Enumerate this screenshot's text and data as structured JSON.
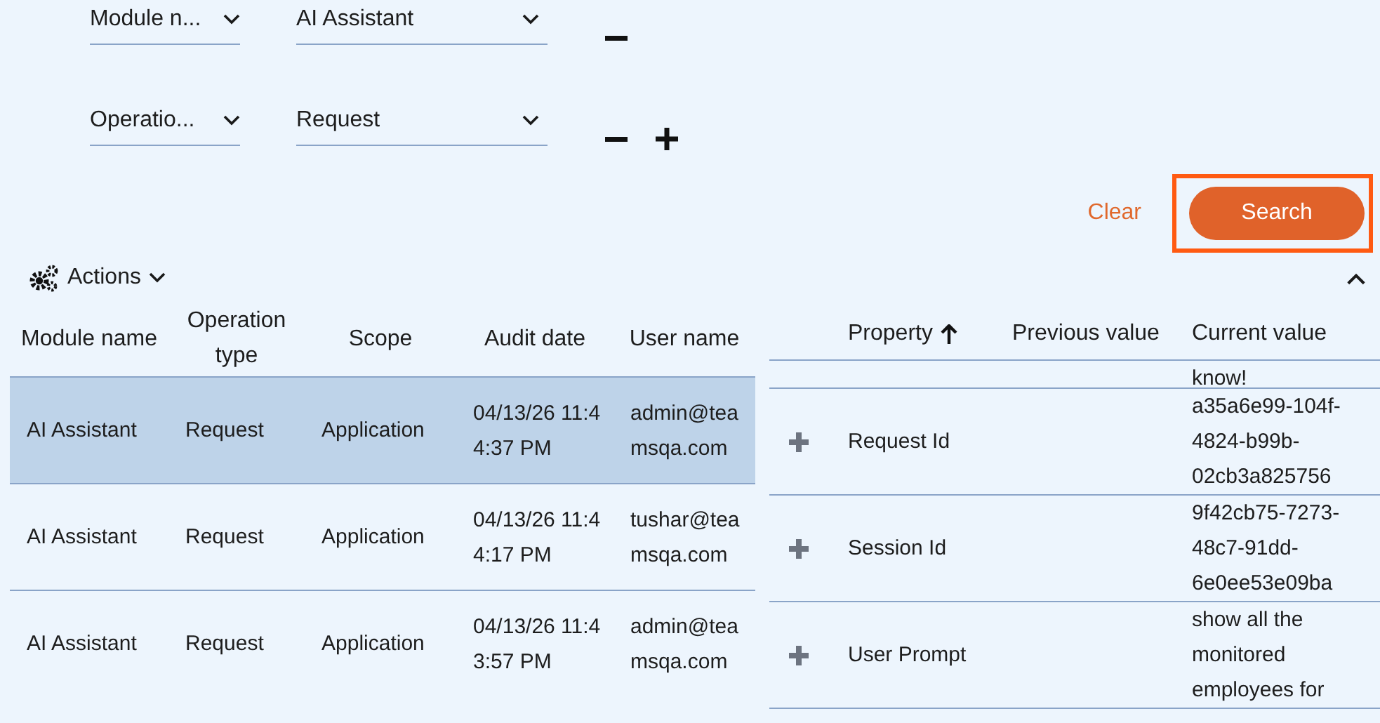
{
  "filters": [
    {
      "field": "Module n...",
      "value": "AI Assistant",
      "removable": true,
      "addable": false
    },
    {
      "field": "Operatio...",
      "value": "Request",
      "removable": true,
      "addable": true
    }
  ],
  "buttons": {
    "clear": "Clear",
    "search": {
      "label": "Search",
      "focused": true
    }
  },
  "actions_menu": {
    "label": "Actions"
  },
  "panel": {
    "expanded": true
  },
  "audit_table": {
    "columns": [
      "Module name",
      "Operation type",
      "Scope",
      "Audit date",
      "User name"
    ],
    "rows": [
      {
        "selected": true,
        "cells": [
          "AI Assistant",
          "Request",
          "Application",
          "04/13/26 11:44:37 PM",
          "admin@teamsqa.com"
        ]
      },
      {
        "selected": false,
        "cells": [
          "AI Assistant",
          "Request",
          "Application",
          "04/13/26 11:44:17 PM",
          "tushar@teamsqa.com"
        ]
      },
      {
        "selected": false,
        "cells": [
          "AI Assistant",
          "Request",
          "Application",
          "04/13/26 11:43:57 PM",
          "admin@teamsqa.com"
        ]
      }
    ]
  },
  "details_table": {
    "columns": [
      {
        "label": "Property",
        "sorted_ascending": true
      },
      {
        "label": "Previous value",
        "sorted_ascending": false
      },
      {
        "label": "Current value",
        "sorted_ascending": false
      }
    ],
    "rows": [
      {
        "kind": "partial",
        "property": "",
        "previous": "",
        "current": "know!"
      },
      {
        "kind": "row",
        "property": "Request Id",
        "previous": "",
        "current": "a35a6e99-104f-4824-b99b-02cb3a825756"
      },
      {
        "kind": "row",
        "property": "Session Id",
        "previous": "",
        "current": "9f42cb75-7273-48c7-91dd-6e0ee53e09ba"
      },
      {
        "kind": "row",
        "property": "User Prompt",
        "previous": "",
        "current": "show all the monitored employees for"
      }
    ]
  }
}
